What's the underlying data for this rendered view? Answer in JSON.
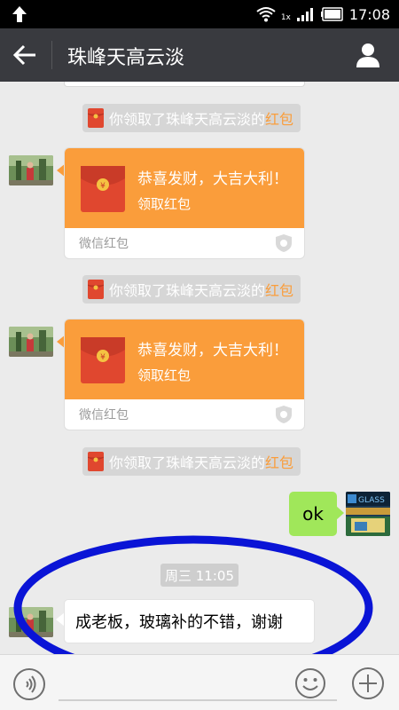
{
  "status_bar": {
    "time": "17:08",
    "network_label": "1x",
    "icons": [
      "upload-arrow-icon",
      "wifi-icon",
      "signal-icon",
      "battery-icon"
    ]
  },
  "header": {
    "title": "珠峰天高云淡",
    "back_icon": "back-arrow-icon",
    "profile_icon": "person-icon"
  },
  "messages": {
    "system_notices": [
      {
        "prefix": "你领取了珠峰天高云淡的",
        "link": "红包"
      },
      {
        "prefix": "你领取了珠峰天高云淡的",
        "link": "红包"
      },
      {
        "prefix": "你领取了珠峰天高云淡的",
        "link": "红包"
      }
    ],
    "red_packets": [
      {
        "greeting": "恭喜发财，大吉大利！",
        "action": "领取红包",
        "footer": "微信红包"
      },
      {
        "greeting": "恭喜发财，大吉大利！",
        "action": "领取红包",
        "footer": "微信红包"
      }
    ],
    "outgoing_text": "ok",
    "timestamp": "周三 11:05",
    "incoming_text": "成老板，玻璃补的不错，谢谢"
  },
  "colors": {
    "header_bg": "#393a3f",
    "red_packet": "#fa9d3b",
    "outgoing_bubble": "#a0e75a",
    "annotation": "#0a14d6"
  }
}
